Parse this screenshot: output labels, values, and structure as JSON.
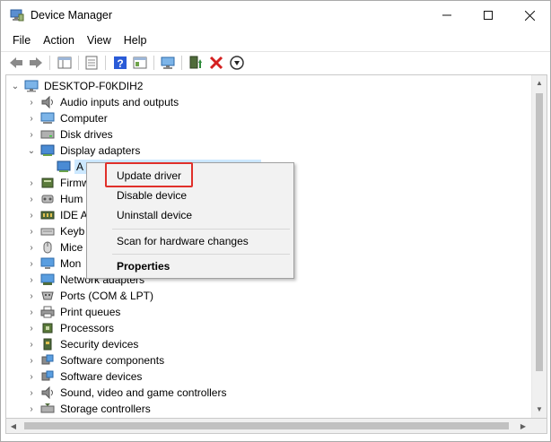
{
  "window": {
    "title": "Device Manager",
    "minimize": "—",
    "maximize": "☐",
    "close": "✕"
  },
  "menu": [
    "File",
    "Action",
    "View",
    "Help"
  ],
  "tree": {
    "root": "DESKTOP-F0KDIH2",
    "items": [
      {
        "label": "Audio inputs and outputs",
        "icon": "speaker-icon",
        "expanded": false
      },
      {
        "label": "Computer",
        "icon": "computer-icon",
        "expanded": false
      },
      {
        "label": "Disk drives",
        "icon": "disk-drive-icon",
        "expanded": false
      },
      {
        "label": "Display adapters",
        "icon": "display-adapter-icon",
        "expanded": true
      },
      {
        "label": "A",
        "icon": "display-adapter-icon",
        "child": true,
        "selected": true
      },
      {
        "label": "Firmw",
        "icon": "firmware-icon",
        "expanded": false
      },
      {
        "label": "Hum",
        "icon": "hid-icon",
        "expanded": false
      },
      {
        "label": "IDE A",
        "icon": "ide-controller-icon",
        "expanded": false
      },
      {
        "label": "Keyb",
        "icon": "keyboard-icon",
        "expanded": false
      },
      {
        "label": "Mice",
        "icon": "mouse-icon",
        "expanded": false
      },
      {
        "label": "Mon",
        "icon": "monitor-icon",
        "expanded": false
      },
      {
        "label": "Network adapters",
        "icon": "network-adapter-icon",
        "expanded": false
      },
      {
        "label": "Ports (COM & LPT)",
        "icon": "port-icon",
        "expanded": false
      },
      {
        "label": "Print queues",
        "icon": "printer-icon",
        "expanded": false
      },
      {
        "label": "Processors",
        "icon": "processor-icon",
        "expanded": false
      },
      {
        "label": "Security devices",
        "icon": "security-device-icon",
        "expanded": false
      },
      {
        "label": "Software components",
        "icon": "software-component-icon",
        "expanded": false
      },
      {
        "label": "Software devices",
        "icon": "software-device-icon",
        "expanded": false
      },
      {
        "label": "Sound, video and game controllers",
        "icon": "speaker-icon",
        "expanded": false
      },
      {
        "label": "Storage controllers",
        "icon": "storage-controller-icon",
        "expanded": false
      }
    ]
  },
  "context_menu": {
    "update_driver": "Update driver",
    "disable_device": "Disable device",
    "uninstall_device": "Uninstall device",
    "scan": "Scan for hardware changes",
    "properties": "Properties"
  },
  "colors": {
    "highlight_box": "#e0302a",
    "selection": "#cce8ff",
    "toolbar_green": "#2e8b3a",
    "toolbar_red": "#d42020",
    "help_blue": "#2a5bd7"
  }
}
